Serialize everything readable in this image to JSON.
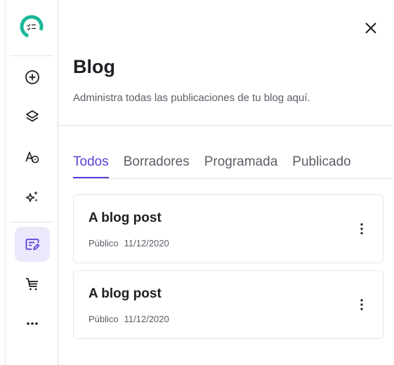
{
  "colors": {
    "accent": "#5b3fd6",
    "active_bg": "#ebe8fb",
    "logo_green": "#1bb89a"
  },
  "sidebar": {
    "items": [
      {
        "icon": "plus-circle-icon"
      },
      {
        "icon": "layers-icon"
      },
      {
        "icon": "text-style-icon"
      },
      {
        "icon": "sparkles-icon"
      },
      {
        "icon": "blog-edit-icon",
        "active": true
      },
      {
        "icon": "cart-icon"
      },
      {
        "icon": "more-horizontal-icon"
      }
    ]
  },
  "header": {
    "title": "Blog",
    "subtitle": "Administra todas las publicaciones de tu blog aquí."
  },
  "tabs": [
    {
      "label": "Todos",
      "active": true
    },
    {
      "label": "Borradores"
    },
    {
      "label": "Programada"
    },
    {
      "label": "Publicado"
    }
  ],
  "posts": [
    {
      "title": "A blog post",
      "visibility": "Público",
      "date": "11/12/2020"
    },
    {
      "title": "A blog post",
      "visibility": "Público",
      "date": "11/12/2020"
    }
  ]
}
